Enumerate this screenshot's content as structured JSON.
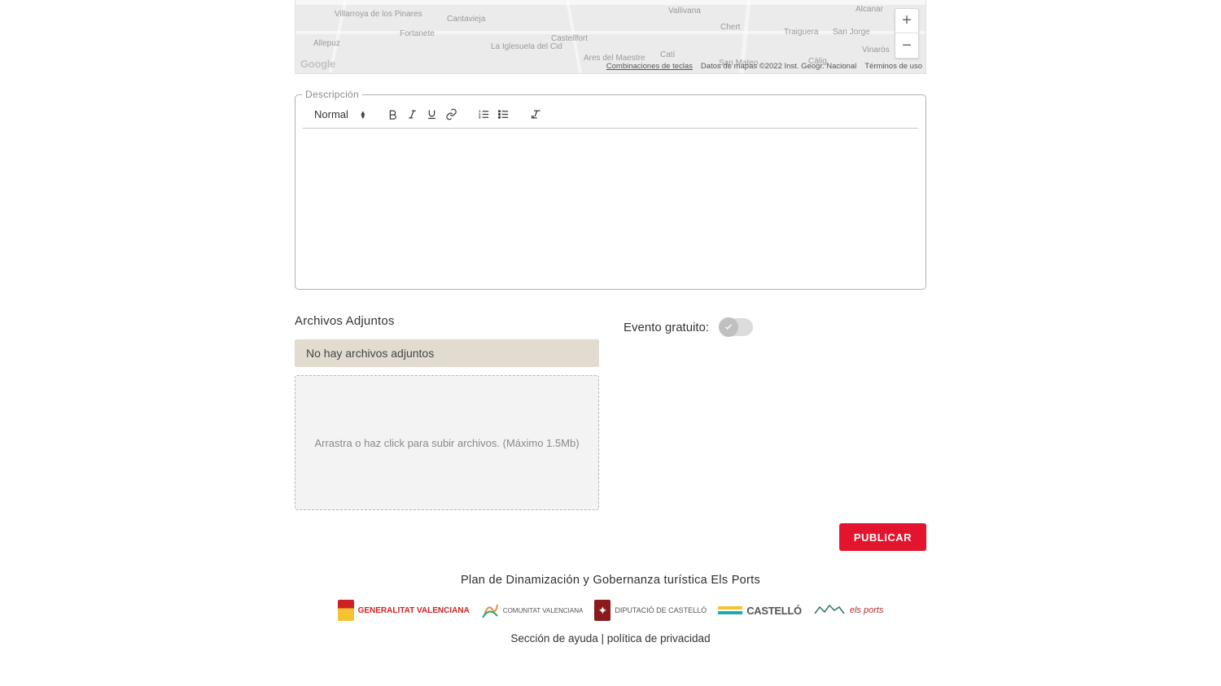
{
  "map": {
    "zoom_in": "+",
    "zoom_out": "−",
    "places": [
      "Villarroya de los Pinares",
      "Cantavieja",
      "Vallivana",
      "Alcanar",
      "Allepuz",
      "Fortanete",
      "Castellfort",
      "Chert",
      "Traiguera",
      "San Jorge",
      "La Iglesuela del Cid",
      "Ares del Maestre",
      "Catí",
      "Vinaròs",
      "San Mateo",
      "Càlig"
    ],
    "google": "Google",
    "attrib_shortcut": "Combinaciones de teclas",
    "attrib_data": "Datos de mapas ©2022 Inst. Geogr. Nacional",
    "attrib_terms": "Términos de uso"
  },
  "editor": {
    "legend": "Descripción",
    "format_select": "Normal"
  },
  "attachments": {
    "title": "Archivos Adjuntos",
    "empty": "No hay archivos adjuntos",
    "dropzone": "Arrastra o haz click para subir archivos. (Máximo 1.5Mb)"
  },
  "toggle": {
    "label": "Evento gratuito:"
  },
  "actions": {
    "publish": "PUBLICAR"
  },
  "footer": {
    "plan": "Plan de Dinamización y Gobernanza turística Els Ports",
    "logos": [
      {
        "name": "GENERALITAT VALENCIANA"
      },
      {
        "name": "COMUNITAT VALENCIANA"
      },
      {
        "name": "DIPUTACIÓ DE CASTELLÓ"
      },
      {
        "name": "CASTELLÓ"
      },
      {
        "name": "els ports"
      }
    ],
    "link_help": "Sección de ayuda",
    "sep": " | ",
    "link_privacy": "política de privacidad"
  }
}
